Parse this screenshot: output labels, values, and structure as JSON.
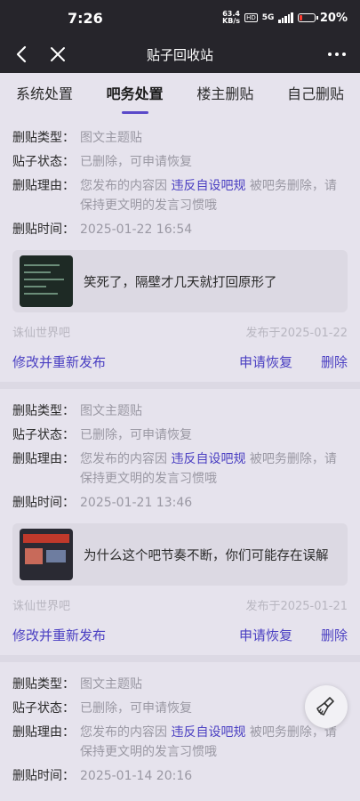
{
  "status_bar": {
    "time": "7:26",
    "net_speed_value": "63.4",
    "net_speed_unit": "KB/s",
    "hd": "HD",
    "network": "5G",
    "battery": "20%"
  },
  "nav": {
    "title": "贴子回收站",
    "back_icon": "chevron-left-icon",
    "close_icon": "close-icon",
    "more_icon": "more-dots-icon"
  },
  "tabs": [
    {
      "label": "系统处置",
      "active": false
    },
    {
      "label": "吧务处置",
      "active": true
    },
    {
      "label": "楼主删贴",
      "active": false
    },
    {
      "label": "自己删贴",
      "active": false
    }
  ],
  "labels": {
    "type": "删贴类型：",
    "status": "贴子状态：",
    "reason": "删贴理由：",
    "time": "删贴时间："
  },
  "cards": [
    {
      "type": "图文主题贴",
      "status": "已删除，可申请恢复",
      "reason_pre": "您发布的内容因 ",
      "reason_rule": "违反自设吧规",
      "reason_post": " 被吧务删除，请保持更文明的发言习惯哦",
      "time": "2025-01-22 16:54",
      "post_text": "笑死了，隔壁才几天就打回原形了",
      "forum": "诛仙世界吧",
      "published": "发布于2025-01-22",
      "repost": "修改并重新发布",
      "restore": "申请恢复",
      "delete": "删除"
    },
    {
      "type": "图文主题贴",
      "status": "已删除，可申请恢复",
      "reason_pre": "您发布的内容因 ",
      "reason_rule": "违反自设吧规",
      "reason_post": " 被吧务删除，请保持更文明的发言习惯哦",
      "time": "2025-01-21 13:46",
      "post_text": "为什么这个吧节奏不断，你们可能存在误解",
      "forum": "诛仙世界吧",
      "published": "发布于2025-01-21",
      "repost": "修改并重新发布",
      "restore": "申请恢复",
      "delete": "删除"
    },
    {
      "type": "图文主题贴",
      "status": "已删除，可申请恢复",
      "reason_pre": "您发布的内容因 ",
      "reason_rule": "违反自设吧规",
      "reason_post": " 被吧务删除，请保持更文明的发言习惯哦",
      "time": "2025-01-14 20:16"
    }
  ],
  "fab_icon": "broom-icon"
}
